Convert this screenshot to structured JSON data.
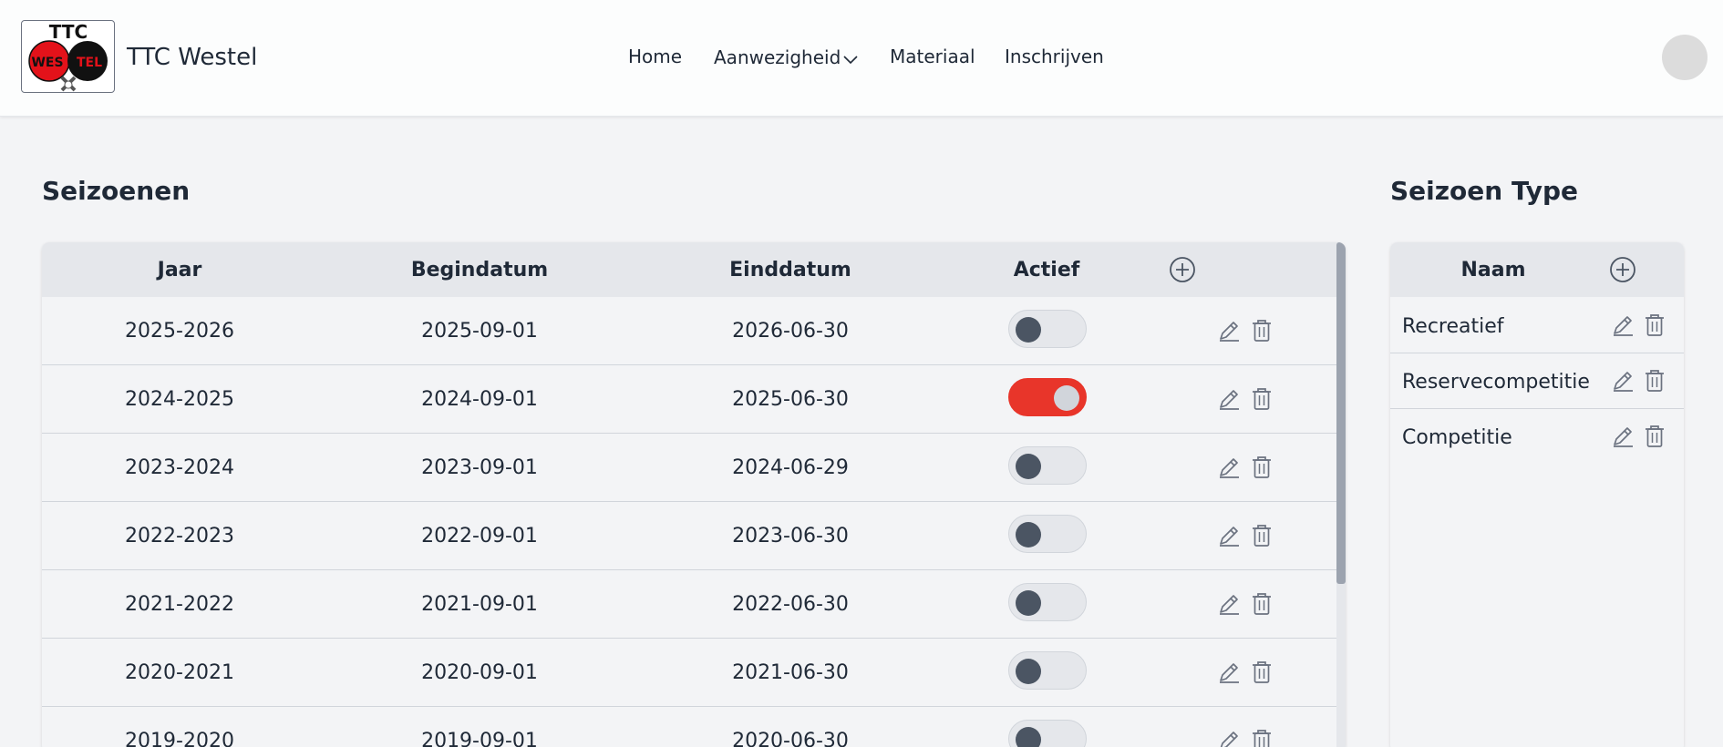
{
  "header": {
    "brand": "TTC Westel",
    "logo_text": {
      "top": "TTC",
      "left": "WES",
      "right": "TEL"
    },
    "nav": [
      {
        "label": "Home"
      },
      {
        "label": "Aanwezigheid",
        "icon": "chevron-down-icon"
      },
      {
        "label": "Materiaal"
      },
      {
        "label": "Inschrijven"
      }
    ]
  },
  "seasons": {
    "title": "Seizoenen",
    "columns": [
      "Jaar",
      "Begindatum",
      "Einddatum",
      "Actief"
    ],
    "rows": [
      {
        "jaar": "2025-2026",
        "begin": "2025-09-01",
        "eind": "2026-06-30",
        "actief": false
      },
      {
        "jaar": "2024-2025",
        "begin": "2024-09-01",
        "eind": "2025-06-30",
        "actief": true
      },
      {
        "jaar": "2023-2024",
        "begin": "2023-09-01",
        "eind": "2024-06-29",
        "actief": false
      },
      {
        "jaar": "2022-2023",
        "begin": "2022-09-01",
        "eind": "2023-06-30",
        "actief": false
      },
      {
        "jaar": "2021-2022",
        "begin": "2021-09-01",
        "eind": "2022-06-30",
        "actief": false
      },
      {
        "jaar": "2020-2021",
        "begin": "2020-09-01",
        "eind": "2021-06-30",
        "actief": false
      },
      {
        "jaar": "2019-2020",
        "begin": "2019-09-01",
        "eind": "2020-06-30",
        "actief": false
      }
    ]
  },
  "season_types": {
    "title": "Seizoen Type",
    "column": "Naam",
    "rows": [
      {
        "naam": "Recreatief"
      },
      {
        "naam": "Reservecompetitie"
      },
      {
        "naam": "Competitie"
      }
    ]
  },
  "colors": {
    "toggle_on": "#e8352a",
    "toggle_off": "#e5e7eb",
    "icon": "#6b7280",
    "header_bg": "#e5e7eb"
  }
}
